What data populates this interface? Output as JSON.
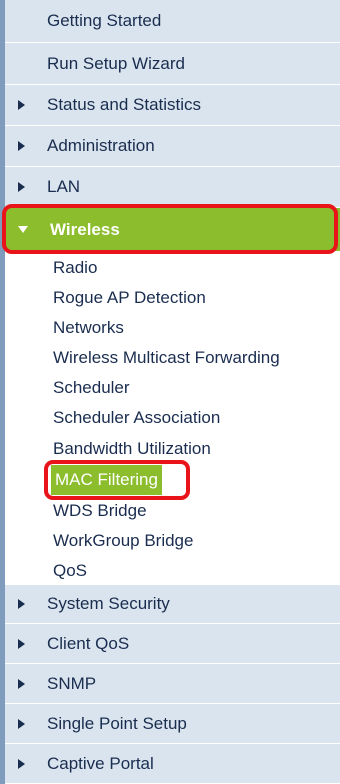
{
  "nav": {
    "top_items": [
      {
        "label": "Getting Started"
      },
      {
        "label": "Run Setup Wizard"
      },
      {
        "label": "Status and Statistics"
      },
      {
        "label": "Administration"
      },
      {
        "label": "LAN"
      }
    ],
    "wireless": {
      "label": "Wireless",
      "expanded": true,
      "highlight_color": "#8cbd2c",
      "annotation_color": "#e8141a",
      "sub_items": [
        {
          "label": "Radio"
        },
        {
          "label": "Rogue AP Detection"
        },
        {
          "label": "Networks"
        },
        {
          "label": "Wireless Multicast Forwarding"
        },
        {
          "label": "Scheduler"
        },
        {
          "label": "Scheduler Association"
        },
        {
          "label": "Bandwidth Utilization"
        },
        {
          "label": "MAC Filtering",
          "selected": true
        },
        {
          "label": "WDS Bridge"
        },
        {
          "label": "WorkGroup Bridge"
        },
        {
          "label": "QoS"
        }
      ]
    },
    "bottom_items": [
      {
        "label": "System Security"
      },
      {
        "label": "Client QoS"
      },
      {
        "label": "SNMP"
      },
      {
        "label": "Single Point Setup"
      },
      {
        "label": "Captive Portal"
      }
    ],
    "colors": {
      "row_background": "#d9e4ee",
      "text": "#1a2d4f",
      "left_rule": "#7f9cbc"
    },
    "icons": {
      "collapsed": "triangle-right-icon",
      "expanded": "triangle-down-icon"
    }
  }
}
